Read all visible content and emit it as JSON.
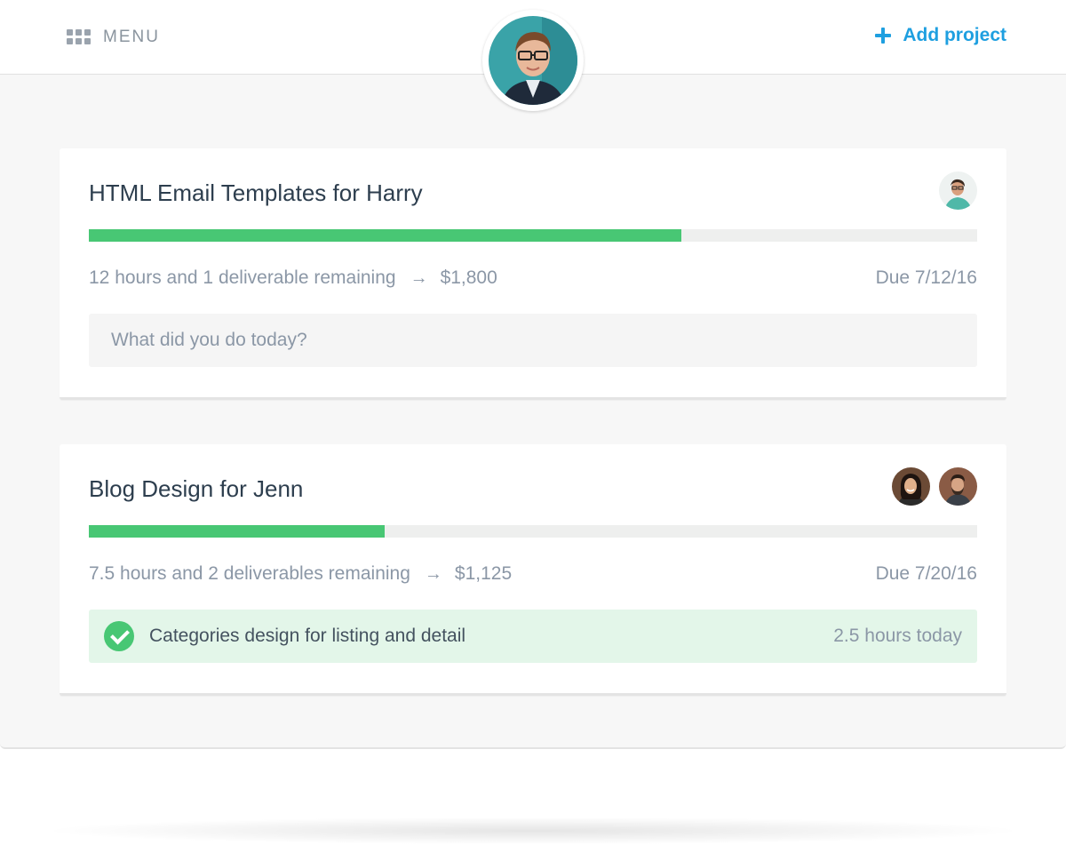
{
  "header": {
    "menu_label": "MENU",
    "add_project_label": "Add project"
  },
  "projects": [
    {
      "title": "HTML Email Templates for Harry",
      "progress_percent": 66.7,
      "remaining": "12 hours and 1 deliverable remaining",
      "amount": "$1,800",
      "due": "Due 7/12/16",
      "entry_placeholder": "What did you do today?",
      "avatars": [
        "avatar-icon"
      ]
    },
    {
      "title": "Blog Design for Jenn",
      "progress_percent": 33.3,
      "remaining": "7.5 hours and 2 deliverables remaining",
      "amount": "$1,125",
      "due": "Due 7/20/16",
      "completed_entry": {
        "text": "Categories design for listing and detail",
        "hours": "2.5 hours today"
      },
      "avatars": [
        "avatar-icon",
        "avatar-icon"
      ]
    }
  ],
  "colors": {
    "accent": "#1e9fe0",
    "progress": "#48c774",
    "done_bg": "#e3f6e9"
  }
}
